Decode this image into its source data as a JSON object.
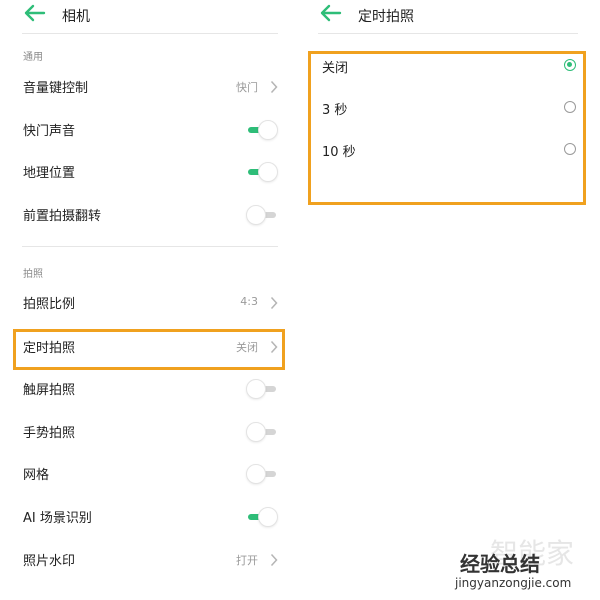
{
  "left_panel": {
    "title": "相机",
    "sections": {
      "general": "通用",
      "photo": "拍照"
    },
    "rows": {
      "volume_key": {
        "label": "音量键控制",
        "value": "快门"
      },
      "shutter_sound": {
        "label": "快门声音",
        "on": true
      },
      "location": {
        "label": "地理位置",
        "on": true
      },
      "front_mirror": {
        "label": "前置拍摄翻转",
        "on": false
      },
      "aspect_ratio": {
        "label": "拍照比例",
        "value": "4:3"
      },
      "timer": {
        "label": "定时拍照",
        "value": "关闭"
      },
      "touch_shot": {
        "label": "触屏拍照",
        "on": false
      },
      "gesture_shot": {
        "label": "手势拍照",
        "on": false
      },
      "grid": {
        "label": "网格",
        "on": false
      },
      "ai_scene": {
        "label": "AI 场景识别",
        "on": true
      },
      "watermark": {
        "label": "照片水印",
        "value": "打开"
      }
    }
  },
  "right_panel": {
    "title": "定时拍照",
    "options": [
      {
        "label": "关闭",
        "selected": true
      },
      {
        "label": "3 秒",
        "selected": false
      },
      {
        "label": "10 秒",
        "selected": false
      }
    ]
  },
  "watermark": {
    "brand": "经验总结",
    "url": "jingyanzongjie.com",
    "faint": "智能家"
  },
  "colors": {
    "accent": "#2ebd78",
    "highlight": "#f0a11f"
  }
}
